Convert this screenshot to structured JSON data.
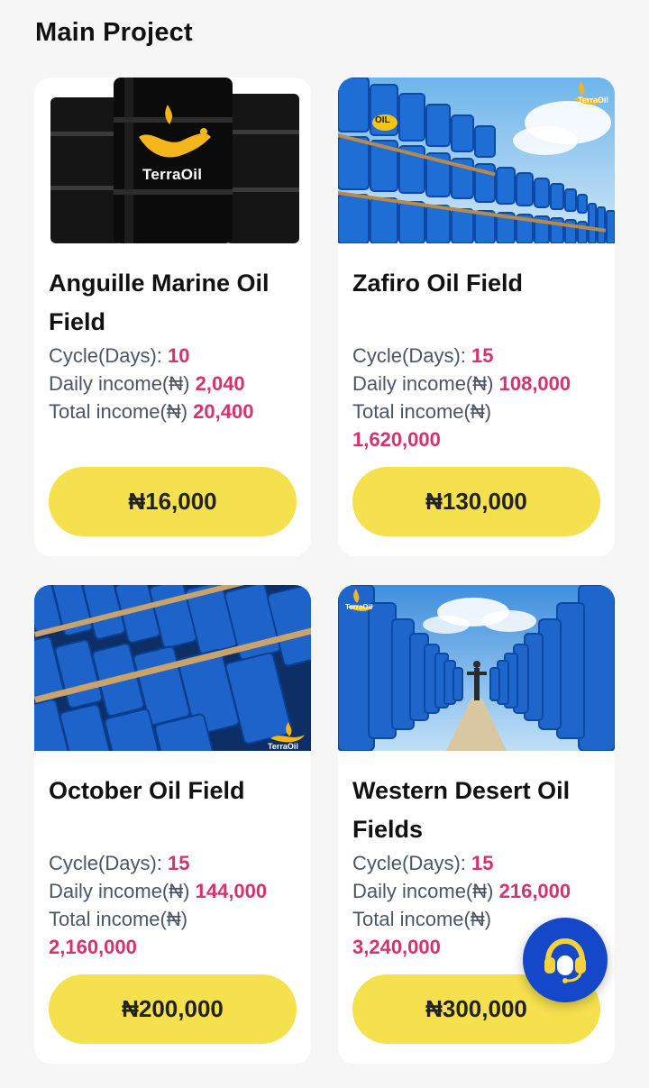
{
  "header": {
    "title": "Main Project"
  },
  "projects": [
    {
      "name": "Anguille Marine Oil Field",
      "cycle_label": "Cycle(Days):",
      "cycle_value": "10",
      "daily_label": "Daily income(₦)",
      "daily_value": "2,040",
      "total_label": "Total income(₦)",
      "total_value": "20,400",
      "price": "₦16,000",
      "image": "black-oil-barrels-terraoil",
      "logo_text": "TerraOil"
    },
    {
      "name": "Zafiro Oil Field",
      "cycle_label": "Cycle(Days):",
      "cycle_value": "15",
      "daily_label": "Daily income(₦)",
      "daily_value": "108,000",
      "total_label": "Total income(₦)",
      "total_value": "1,620,000",
      "price": "₦130,000",
      "image": "blue-oil-barrels-stacked",
      "logo_text": "TerraOil",
      "barrel_text": "OIL"
    },
    {
      "name": "October Oil Field",
      "cycle_label": "Cycle(Days):",
      "cycle_value": "15",
      "daily_label": "Daily income(₦)",
      "daily_value": "144,000",
      "total_label": "Total income(₦)",
      "total_value": "2,160,000",
      "price": "₦200,000",
      "image": "blue-oil-barrels-pallets",
      "logo_text": "TerraOil"
    },
    {
      "name": "Western Desert Oil Fields",
      "cycle_label": "Cycle(Days):",
      "cycle_value": "15",
      "daily_label": "Daily income(₦)",
      "daily_value": "216,000",
      "total_label": "Total income(₦)",
      "total_value": "3,240,000",
      "price": "₦300,000",
      "image": "blue-barrel-rows-desert",
      "logo_text": "TerraOil"
    }
  ],
  "support": {
    "icon": "headset-icon"
  },
  "colors": {
    "accent": "#f5e04d",
    "value": "#d3336e",
    "fab": "#1448c8"
  }
}
